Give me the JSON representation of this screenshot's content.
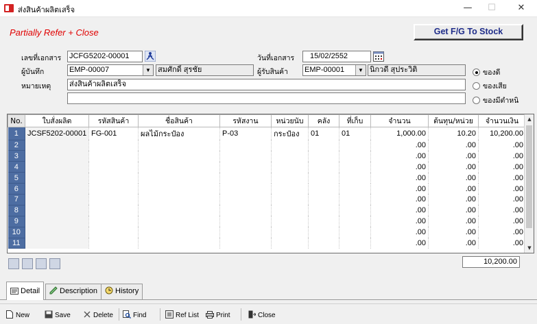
{
  "window": {
    "title": "ส่งสินค้าผลิตเสร็จ",
    "minimize": "—",
    "maximize": "☐",
    "close": "✕"
  },
  "header": {
    "mode_title": "Partially Refer + Close",
    "get_fg_button": "Get F/G To Stock"
  },
  "form": {
    "doc_no_label": "เลขที่เอกสาร",
    "doc_no": "JCFG5202-00001",
    "doc_date_label": "วันที่เอกสาร",
    "doc_date": "15/02/2552",
    "recorder_label": "ผู้บันทึก",
    "recorder_code": "EMP-00007",
    "recorder_name": "สมศักดิ์ สุรชัย",
    "receiver_label": "ผู้รับสินค้า",
    "receiver_code": "EMP-00001",
    "receiver_name": "นิกวดี สุประวิติ",
    "remark_label": "หมายเหตุ",
    "remark": "ส่งสินค้าผลิตเสร็จ",
    "remark2": "",
    "radio_good": "ของดี",
    "radio_bad": "ของเสีย",
    "radio_defect": "ของมีตำหนิ"
  },
  "table": {
    "columns": [
      "No.",
      "ใบสั่งผลิต",
      "รหัสสินค้า",
      "ชื่อสินค้า",
      "รหัสงาน",
      "หน่วยนับ",
      "คลัง",
      "ที่เก็บ",
      "จำนวน",
      "ต้นทุน/หน่วย",
      "จำนวนเงิน"
    ],
    "rows": [
      [
        "1",
        "JCSF5202-00001",
        "FG-001",
        "ผลไม้กระป๋อง",
        "P-03",
        "กระป๋อง",
        "01",
        "01",
        "1,000.00",
        "10.20",
        "10,200.00"
      ],
      [
        "2",
        "",
        "",
        "",
        "",
        "",
        "",
        "",
        ".00",
        ".00",
        ".00"
      ],
      [
        "3",
        "",
        "",
        "",
        "",
        "",
        "",
        "",
        ".00",
        ".00",
        ".00"
      ],
      [
        "4",
        "",
        "",
        "",
        "",
        "",
        "",
        "",
        ".00",
        ".00",
        ".00"
      ],
      [
        "5",
        "",
        "",
        "",
        "",
        "",
        "",
        "",
        ".00",
        ".00",
        ".00"
      ],
      [
        "6",
        "",
        "",
        "",
        "",
        "",
        "",
        "",
        ".00",
        ".00",
        ".00"
      ],
      [
        "7",
        "",
        "",
        "",
        "",
        "",
        "",
        "",
        ".00",
        ".00",
        ".00"
      ],
      [
        "8",
        "",
        "",
        "",
        "",
        "",
        "",
        "",
        ".00",
        ".00",
        ".00"
      ],
      [
        "9",
        "",
        "",
        "",
        "",
        "",
        "",
        "",
        ".00",
        ".00",
        ".00"
      ],
      [
        "10",
        "",
        "",
        "",
        "",
        "",
        "",
        "",
        ".00",
        ".00",
        ".00"
      ],
      [
        "11",
        "",
        "",
        "",
        "",
        "",
        "",
        "",
        ".00",
        ".00",
        ".00"
      ]
    ],
    "total": "10,200.00"
  },
  "tabs": [
    {
      "label": "Detail",
      "icon": "detail-icon"
    },
    {
      "label": "Description",
      "icon": "description-icon"
    },
    {
      "label": "History",
      "icon": "history-icon"
    }
  ],
  "toolbar": {
    "new": "New",
    "save": "Save",
    "delete": "Delete",
    "find": "Find",
    "ref_list": "Ref List",
    "print": "Print",
    "close": "Close"
  },
  "colors": {
    "title_red": "#e00000",
    "button_blue_text": "#1f2d8a",
    "row_number_bg": "#4d6da2"
  }
}
